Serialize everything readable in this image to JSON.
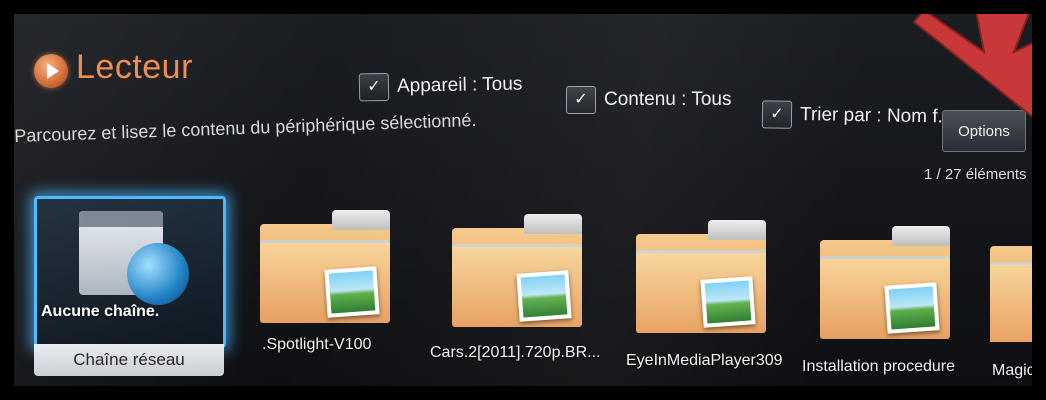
{
  "app": {
    "title": "Lecteur",
    "description": "Parcourez et lisez le contenu du périphérique sélectionné."
  },
  "filters": [
    {
      "label": "Appareil : Tous",
      "icon": "chevron-down-icon"
    },
    {
      "label": "Contenu : Tous",
      "icon": "chevron-down-icon"
    },
    {
      "label": "Trier par : Nom f...",
      "icon": "chevron-down-icon"
    }
  ],
  "options_label": "Options",
  "item_count": "1 / 27 éléments",
  "items": [
    {
      "inner_label": "Aucune chaîne.",
      "label": "Chaîne réseau",
      "selected": true,
      "icon": "network-channel-icon"
    },
    {
      "label": ".Spotlight-V100",
      "icon": "folder-icon"
    },
    {
      "label": "Cars.2[2011].720p.BR...",
      "icon": "folder-icon"
    },
    {
      "label": "EyeInMediaPlayer309",
      "icon": "folder-icon"
    },
    {
      "label": "Installation procedure",
      "icon": "folder-icon"
    },
    {
      "label": "Magic",
      "icon": "folder-icon"
    }
  ],
  "colors": {
    "accent": "#f08a4b",
    "selection": "#4ab8ff",
    "arrow": "#d23a3a"
  }
}
